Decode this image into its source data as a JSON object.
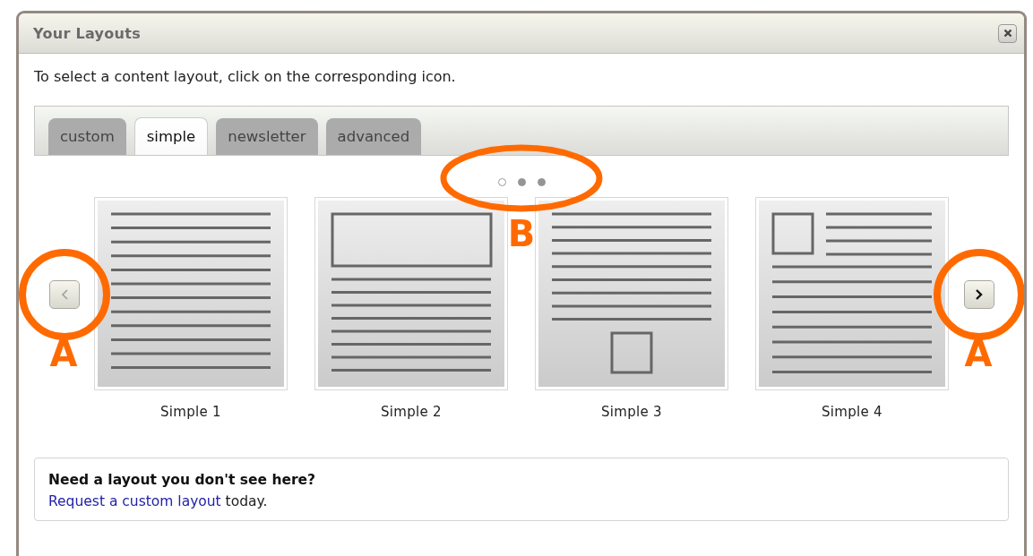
{
  "window": {
    "title": "Your Layouts"
  },
  "instruction": "To select a content layout, click on the corresponding icon.",
  "tabs": [
    {
      "label": "custom",
      "selected": false
    },
    {
      "label": "simple",
      "selected": true
    },
    {
      "label": "newsletter",
      "selected": false
    },
    {
      "label": "advanced",
      "selected": false
    }
  ],
  "pager": {
    "annotation": "B",
    "dots": [
      {
        "selected": true
      },
      {
        "selected": false
      },
      {
        "selected": false
      }
    ]
  },
  "prev_button": {
    "disabled": true,
    "annotation": "A"
  },
  "next_button": {
    "disabled": false,
    "annotation": "A"
  },
  "layouts": [
    {
      "name": "Simple 1",
      "kind": "lines"
    },
    {
      "name": "Simple 2",
      "kind": "header-block"
    },
    {
      "name": "Simple 3",
      "kind": "footer-block"
    },
    {
      "name": "Simple 4",
      "kind": "side-block"
    }
  ],
  "info_box": {
    "heading": "Need a layout you don't see here?",
    "link": "Request a custom layout",
    "text": " today."
  }
}
